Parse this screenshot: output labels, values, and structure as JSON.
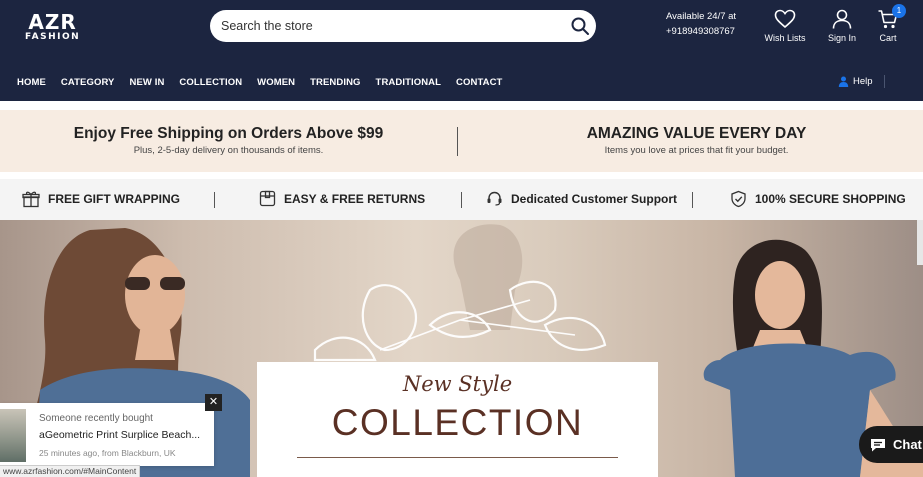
{
  "brand": {
    "logo_main": "AZR",
    "logo_sub": "FASHION"
  },
  "search": {
    "placeholder": "Search the store"
  },
  "availability": {
    "line1": "Available 24/7 at",
    "phone": "+918949308767"
  },
  "header_actions": {
    "wishlist": "Wish Lists",
    "signin": "Sign In",
    "cart": "Cart",
    "cart_count": "1"
  },
  "nav": {
    "items": [
      "HOME",
      "CATEGORY",
      "NEW IN",
      "COLLECTION",
      "WOMEN",
      "TRENDING",
      "TRADITIONAL",
      "CONTACT"
    ],
    "help": "Help"
  },
  "promo": {
    "left_title": "Enjoy Free Shipping on Orders Above $99",
    "left_sub": "Plus, 2-5-day delivery on thousands of items.",
    "right_title": "AMAZING VALUE EVERY DAY",
    "right_sub": "Items you love at prices that fit your budget."
  },
  "features": [
    "FREE GIFT WRAPPING",
    "EASY & FREE RETURNS",
    "Dedicated Customer Support",
    "100% SECURE SHOPPING"
  ],
  "hero": {
    "script_title": "New Style",
    "main_title": "COLLECTION"
  },
  "popup": {
    "line1": "Someone recently bought",
    "line2": "aGeometric Print Surplice Beach...",
    "line3": "25 minutes ago, from Blackburn, UK",
    "close": "✕"
  },
  "status_url": "www.azrfashion.com/#MainContent",
  "chat": {
    "label": "Chat"
  },
  "colors": {
    "header_bg": "#1c2540",
    "promo_bg": "#f7ece2",
    "accent": "#1a73e8",
    "collection_text": "#5a3024"
  },
  "icons": [
    "search-icon",
    "heart-icon",
    "user-icon",
    "cart-icon",
    "person-icon",
    "gift-icon",
    "box-icon",
    "headset-icon",
    "shield-icon",
    "close-icon",
    "chat-icon"
  ]
}
